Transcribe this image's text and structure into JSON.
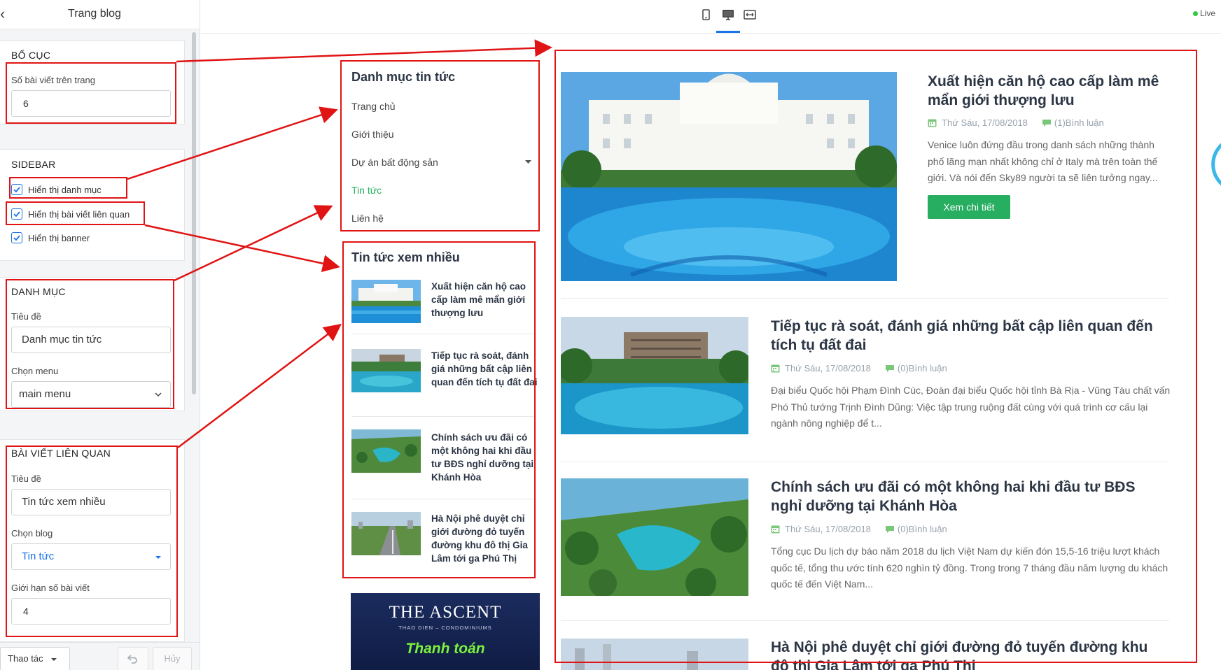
{
  "panel": {
    "title": "Trang blog",
    "layout": {
      "title": "BỐ CỤC",
      "posts_label": "Số bài viết trên trang",
      "posts_value": "6"
    },
    "sidebar": {
      "title": "SIDEBAR",
      "options": [
        {
          "label": "Hiển thị danh mục",
          "checked": true
        },
        {
          "label": "Hiển thị bài viết liên quan",
          "checked": true
        },
        {
          "label": "Hiển thị banner",
          "checked": true
        }
      ]
    },
    "category": {
      "title": "DANH MỤC",
      "title_label": "Tiêu đề",
      "title_value": "Danh mục tin tức",
      "menu_label": "Chọn menu",
      "menu_value": "main menu"
    },
    "related": {
      "title": "BÀI VIẾT LIÊN QUAN",
      "title_label": "Tiêu đề",
      "title_value": "Tin tức xem nhiều",
      "blog_label": "Chọn blog",
      "blog_value": "Tin tức",
      "limit_label": "Giới hạn số bài viết",
      "limit_value": "4"
    },
    "footer": {
      "actions": "Thao tác",
      "cancel": "Hủy"
    }
  },
  "topbar": {
    "live": "Live",
    "active_device": "desktop"
  },
  "preview": {
    "categories": {
      "title": "Danh mục tin tức",
      "items": [
        {
          "label": "Trang chủ",
          "active": false
        },
        {
          "label": "Giới thiệu",
          "active": false
        },
        {
          "label": "Dự án bất động sản",
          "active": false,
          "has_children": true
        },
        {
          "label": "Tin tức",
          "active": true
        },
        {
          "label": "Liên hệ",
          "active": false
        }
      ]
    },
    "popular": {
      "title": "Tin tức xem nhiều",
      "items": [
        {
          "title": "Xuất hiện căn hộ cao cấp làm mê mẩn giới thượng lưu"
        },
        {
          "title": "Tiếp tục rà soát, đánh giá những bất cập liên quan đến tích tụ đất đai"
        },
        {
          "title": "Chính sách ưu đãi có một không hai khi đầu tư BĐS nghỉ dưỡng tại Khánh Hòa"
        },
        {
          "title": "Hà Nội phê duyệt chỉ giới đường đỏ tuyến đường khu đô thị Gia Lâm tới ga Phú Thị"
        }
      ]
    },
    "banner": {
      "brand": "THE ASCENT",
      "sub": "THAO DIEN – CONDOMINIUMS",
      "pay": "Thanh toán"
    },
    "posts": [
      {
        "title": "Xuất hiện căn hộ cao cấp làm mê mẩn giới thượng lưu",
        "date": "Thứ Sáu, 17/08/2018",
        "comments": "(1)Bình luận",
        "excerpt": "Venice luôn đứng đầu trong danh sách những thành phố lãng mạn nhất không chỉ ở Italy mà trên toàn thế giới. Và nói đến Sky89 người ta sẽ liên tưởng ngay...",
        "button": "Xem chi tiết"
      },
      {
        "title": "Tiếp tục rà soát, đánh giá những bất cập liên quan đến tích tụ đất đai",
        "date": "Thứ Sáu, 17/08/2018",
        "comments": "(0)Bình luận",
        "excerpt": "Đại biểu Quốc hội Phạm Đình Cúc, Đoàn đại biểu Quốc hội tỉnh Bà Rịa - Vũng Tàu chất vấn Phó Thủ tướng Trịnh Đình Dũng: Việc tập trung ruộng đất cùng với quá trình cơ cấu lại ngành nông nghiệp để t..."
      },
      {
        "title": "Chính sách ưu đãi có một không hai khi đầu tư BĐS nghỉ dưỡng tại Khánh Hòa",
        "date": "Thứ Sáu, 17/08/2018",
        "comments": "(0)Bình luận",
        "excerpt": "Tổng cục Du lịch dự báo năm 2018 du lịch Việt Nam dự kiến đón 15,5-16 triệu lượt khách quốc tế, tổng thu ước tính 620 nghìn tỷ đồng. Trong trong 7 tháng đầu năm lượng du khách quốc tế đến Việt Nam..."
      },
      {
        "title": "Hà Nội phê duyệt chỉ giới đường đỏ tuyến đường khu đô thị Gia Lâm tới ga Phú Thị"
      }
    ]
  },
  "colors": {
    "accent": "#1a73e8",
    "green": "#27ae60",
    "annotation": "#e01414",
    "heading": "#2b3544"
  },
  "icons": [
    "chevron-left-icon",
    "mobile-icon",
    "desktop-icon",
    "fullwidth-icon",
    "check-icon",
    "chevron-down-icon",
    "caret-down-icon",
    "calendar-icon",
    "comment-icon",
    "undo-icon"
  ]
}
